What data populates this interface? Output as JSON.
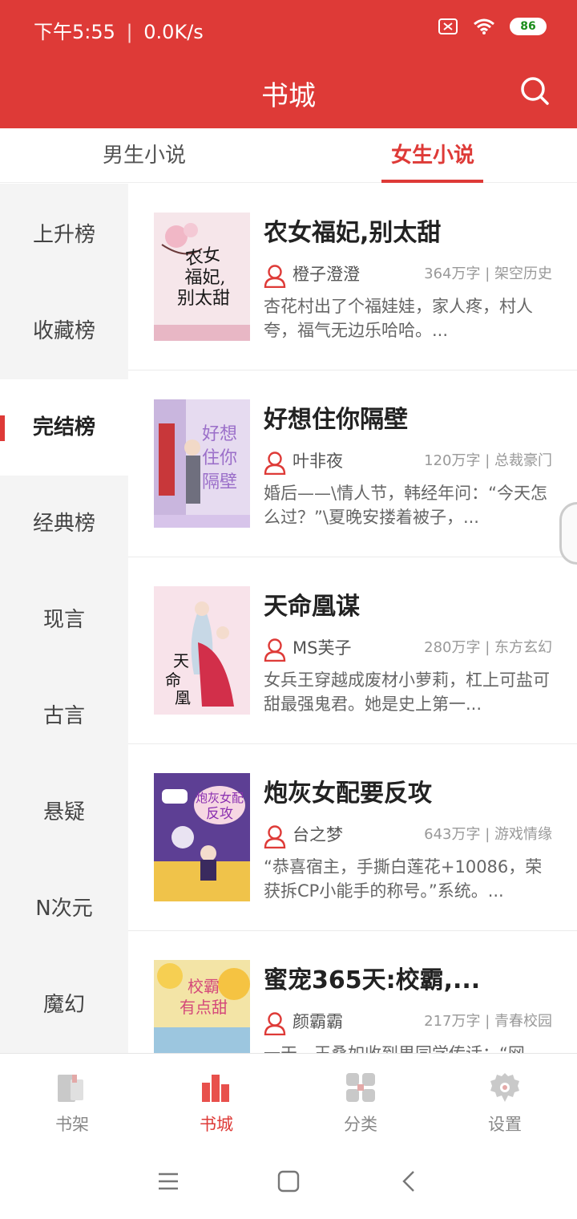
{
  "status": {
    "time": "下午5:55",
    "speed": "0.0K/s",
    "battery": "86"
  },
  "header": {
    "title": "书城"
  },
  "tabs": [
    {
      "label": "男生小说"
    },
    {
      "label": "女生小说"
    }
  ],
  "sidebar": {
    "items": [
      {
        "label": "上升榜"
      },
      {
        "label": "收藏榜"
      },
      {
        "label": "完结榜"
      },
      {
        "label": "经典榜"
      },
      {
        "label": "现言"
      },
      {
        "label": "古言"
      },
      {
        "label": "悬疑"
      },
      {
        "label": "N次元"
      },
      {
        "label": "魔幻"
      }
    ],
    "active_index": 2
  },
  "books": [
    {
      "title": "农女福妃,别太甜",
      "author": "橙子澄澄",
      "words": "364万字",
      "category": "架空历史",
      "meta": "364万字 | 架空历史",
      "desc": "杏花村出了个福娃娃，家人疼，村人夸，福气无边乐哈哈。...",
      "cover_colors": [
        "#f6e6ea",
        "#e3b8c4"
      ]
    },
    {
      "title": "好想住你隔壁",
      "author": "叶非夜",
      "words": "120万字",
      "category": "总裁豪门",
      "meta": "120万字 | 总裁豪门",
      "desc": "婚后——\\情人节，韩经年问：“今天怎么过？”\\夏晚安搂着被子，...",
      "cover_colors": [
        "#d9c4e8",
        "#b4a0d4"
      ]
    },
    {
      "title": "天命凰谋",
      "author": "MS芙子",
      "words": "280万字",
      "category": "东方玄幻",
      "meta": "280万字 | 东方玄幻",
      "desc": "女兵王穿越成废材小萝莉，杠上可盐可甜最强鬼君。她是史上第一...",
      "cover_colors": [
        "#f8dde6",
        "#d0405a"
      ]
    },
    {
      "title": "炮灰女配要反攻",
      "author": "台之梦",
      "words": "643万字",
      "category": "游戏情缘",
      "meta": "643万字 | 游戏情缘",
      "desc": "“恭喜宿主，手撕白莲花+10086，荣获拆CP小能手的称号。”系统。...",
      "cover_colors": [
        "#6b4aa0",
        "#f2c84b"
      ]
    },
    {
      "title": "蜜宠365天:校霸,...",
      "author": "颜霸霸",
      "words": "217万字",
      "category": "青春校园",
      "meta": "217万字 | 青春校园",
      "desc": "一天，王桑如收到男同学传话：“网...",
      "cover_colors": [
        "#f5d36b",
        "#7bb6d9"
      ]
    }
  ],
  "bottom_nav": [
    {
      "label": "书架"
    },
    {
      "label": "书城"
    },
    {
      "label": "分类"
    },
    {
      "label": "设置"
    }
  ],
  "colors": {
    "accent": "#de3a37"
  }
}
